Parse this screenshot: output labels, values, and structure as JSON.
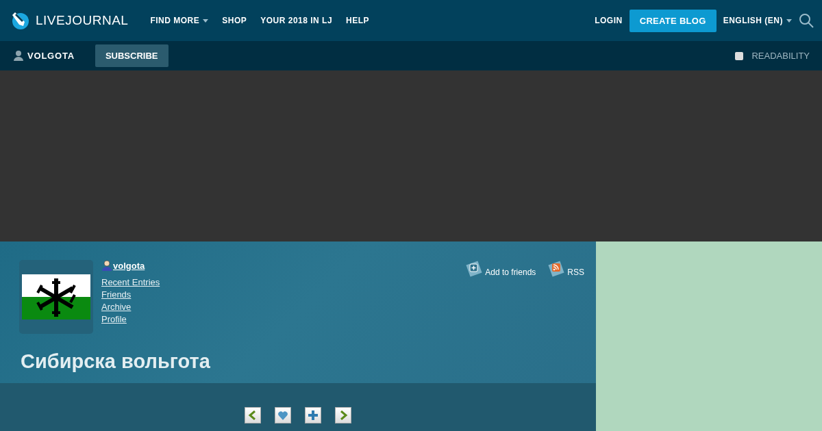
{
  "header": {
    "logo": "LIVEJOURNAL",
    "nav": [
      {
        "label": "FIND MORE",
        "dropdown": true
      },
      {
        "label": "SHOP",
        "dropdown": false
      },
      {
        "label": "YOUR 2018 IN LJ",
        "dropdown": false
      },
      {
        "label": "HELP",
        "dropdown": false
      }
    ],
    "login": "LOGIN",
    "create_blog": "CREATE BLOG",
    "language": "ENGLISH (EN)"
  },
  "subbar": {
    "user": "VOLGOTA",
    "subscribe": "SUBSCRIBE",
    "readability": {
      "label": "READABILITY",
      "checked": false
    }
  },
  "journal": {
    "username": "volgota",
    "links": [
      "Recent Entries",
      "Friends",
      "Archive",
      "Profile"
    ],
    "actions": [
      {
        "kind": "add",
        "label": "Add to friends"
      },
      {
        "kind": "rss",
        "label": "RSS"
      }
    ],
    "title": "Сибирска вольгота"
  },
  "nav_buttons": [
    {
      "kind": "prev"
    },
    {
      "kind": "memories"
    },
    {
      "kind": "add"
    },
    {
      "kind": "next"
    }
  ]
}
